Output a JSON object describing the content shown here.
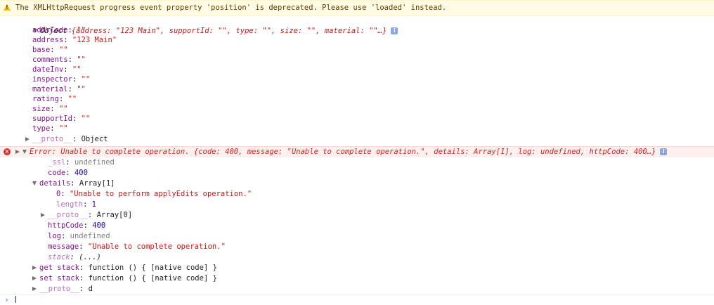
{
  "warning": {
    "text": "The XMLHttpRequest progress event property 'position' is deprecated. Please use 'loaded' instead."
  },
  "object": {
    "summary_prefix": "Object ",
    "summary": "{address: \"123 Main\", supportId: \"\", type: \"\", size: \"\", material: \"\"…}",
    "props": [
      {
        "key": "addrCode",
        "value": "\"\""
      },
      {
        "key": "address",
        "value": "\"123 Main\""
      },
      {
        "key": "base",
        "value": "\"\""
      },
      {
        "key": "comments",
        "value": "\"\""
      },
      {
        "key": "dateInv",
        "value": "\"\""
      },
      {
        "key": "inspector",
        "value": "\"\""
      },
      {
        "key": "material",
        "value": "\"\""
      },
      {
        "key": "rating",
        "value": "\"\""
      },
      {
        "key": "size",
        "value": "\"\""
      },
      {
        "key": "supportId",
        "value": "\"\""
      },
      {
        "key": "type",
        "value": "\"\""
      }
    ],
    "proto_key": "__proto__",
    "proto_value": "Object"
  },
  "error": {
    "summary": "Error: Unable to complete operation. {code: 400, message: \"Unable to complete operation.\", details: Array[1], log: undefined, httpCode: 400…}",
    "ssl_key": "_ssl",
    "ssl_value": "undefined",
    "code_key": "code",
    "code_value": "400",
    "details_key": "details",
    "details_value": "Array[1]",
    "details_0_key": "0",
    "details_0_value": "\"Unable to perform applyEdits operation.\"",
    "length_key": "length",
    "length_value": "1",
    "details_proto_key": "__proto__",
    "details_proto_value": "Array[0]",
    "httpCode_key": "httpCode",
    "httpCode_value": "400",
    "log_key": "log",
    "log_value": "undefined",
    "message_key": "message",
    "message_value": "\"Unable to complete operation.\"",
    "stack_key": "stack",
    "stack_value": "(...)",
    "get_stack_key": "get stack",
    "get_stack_value": "function () { [native code] }",
    "set_stack_key": "set stack",
    "set_stack_value": "function () { [native code] }",
    "proto_key": "__proto__",
    "proto_value": "d"
  },
  "separator": ": ",
  "prompt": "›",
  "colors": {
    "warning_bg": "#fffbe5",
    "error_bg": "#fff0f0",
    "error_text": "#e01e1e",
    "key": "#881391",
    "string": "#c41a16",
    "number": "#1c00cf"
  }
}
